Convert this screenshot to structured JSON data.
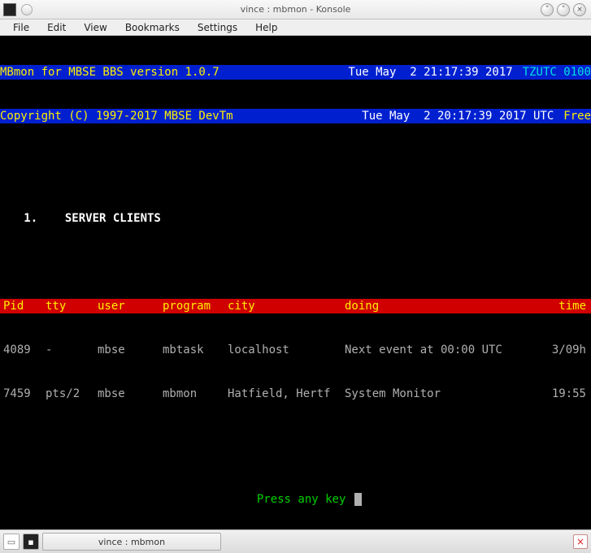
{
  "window": {
    "title": "vince : mbmon - Konsole"
  },
  "menu": {
    "file": "File",
    "edit": "Edit",
    "view": "View",
    "bookmarks": "Bookmarks",
    "settings": "Settings",
    "help": "Help"
  },
  "header1": {
    "left": "MBmon for MBSE BBS version 1.0.7",
    "right": "Tue May  2 21:17:39 2017",
    "tag": "TZUTC 0100"
  },
  "header2": {
    "left": "Copyright (C) 1997-2017 MBSE DevTm",
    "right": "Tue May  2 20:17:39 2017 UTC",
    "tag": "Free"
  },
  "section": {
    "title": "   1.    SERVER CLIENTS"
  },
  "columns": {
    "pid": "Pid",
    "tty": "tty",
    "user": "user",
    "program": "program",
    "city": "city",
    "doing": "doing",
    "time": "time"
  },
  "rows": [
    {
      "pid": "4089",
      "tty": "-",
      "user": "mbse",
      "program": "mbtask",
      "city": "localhost",
      "doing": "Next event at 00:00 UTC",
      "time": "3/09h"
    },
    {
      "pid": "7459",
      "tty": "pts/2",
      "user": "mbse",
      "program": "mbmon",
      "city": "Hatfield, Hertf",
      "doing": "System Monitor",
      "time": "19:55"
    }
  ],
  "prompt": "Press any key ",
  "taskbar": {
    "app": "vince : mbmon"
  }
}
